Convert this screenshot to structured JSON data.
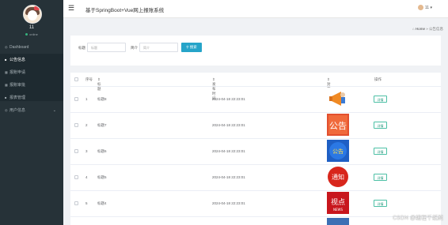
{
  "sidebar": {
    "user_name": "11",
    "status": "online",
    "items": [
      {
        "label": "Dashboard",
        "icon": "dashboard-icon"
      },
      {
        "label": "公告信息",
        "icon": "notice-icon"
      },
      {
        "label": "报账申请",
        "icon": "grid-icon"
      },
      {
        "label": "报账审批",
        "icon": "grid-icon"
      },
      {
        "label": "报表管理",
        "icon": "report-icon"
      },
      {
        "label": "用户信息",
        "icon": "user-icon"
      }
    ]
  },
  "header": {
    "title": "基于SpringBoot+Vue网上报账系统",
    "user_label": "11",
    "user_caret": "▾"
  },
  "breadcrumb": {
    "home": "Home",
    "separator": "»",
    "current": "公告信息"
  },
  "search": {
    "title_label": "标题",
    "title_placeholder": "标题",
    "intro_label": "简介",
    "intro_placeholder": "简介",
    "button_label": "搜索"
  },
  "table": {
    "headers": [
      "序号",
      "标题",
      "发布时间",
      "封面",
      "操作"
    ],
    "rows": [
      {
        "index": "1",
        "title": "标题8",
        "time": "2024-04-18 22:23:01",
        "image": "megaphone",
        "action": "详情"
      },
      {
        "index": "2",
        "title": "标题7",
        "time": "2024-04-18 22:23:01",
        "image": "notice-red",
        "action": "详情"
      },
      {
        "index": "3",
        "title": "标题6",
        "time": "2024-04-18 22:23:01",
        "image": "notice-blue",
        "action": "详情"
      },
      {
        "index": "4",
        "title": "标题5",
        "time": "2024-04-18 22:23:01",
        "image": "notify-red",
        "action": "详情"
      },
      {
        "index": "5",
        "title": "标题4",
        "time": "2024-04-18 22:23:01",
        "image": "news-red",
        "action": "详情"
      }
    ],
    "image_text": {
      "notice-red": "公告",
      "notice-blue": "公告",
      "notify-red": "通知",
      "news-red": "视点"
    }
  },
  "colors": {
    "sidebar_bg": "#263238",
    "accent": "#26a4c9",
    "detail_border": "#4cc0a5"
  },
  "watermark": "CSDN @编程千纸鹤"
}
